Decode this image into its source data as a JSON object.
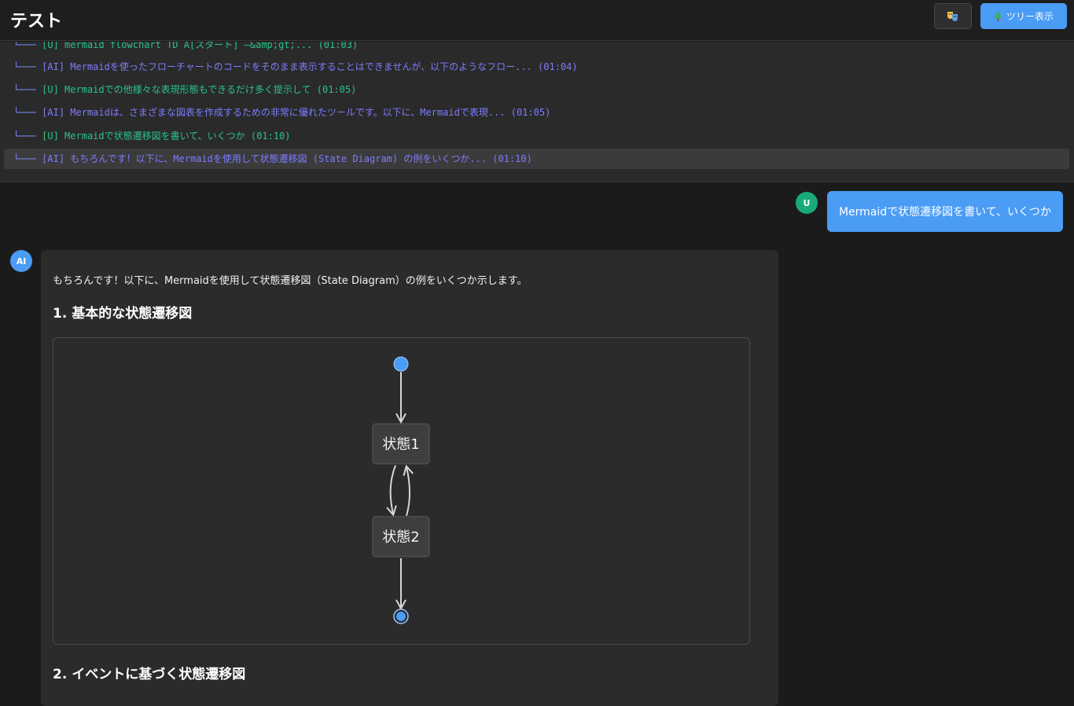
{
  "app": {
    "title": "テスト",
    "theme_icon": "theater-masks-icon",
    "tree_button": {
      "icon": "evergreen-tree-icon",
      "label": "ツリー表示"
    }
  },
  "tree": {
    "connector": "└───",
    "rows": [
      {
        "role": "user",
        "text": "[U]   mermaid flowchart TD A[スタート] —&amp;gt;... (01:03)"
      },
      {
        "role": "ai",
        "text": "[AI] Mermaidを使ったフローチャートのコードをそのまま表示することはできませんが、以下のようなフロー... (01:04)"
      },
      {
        "role": "user",
        "text": "[U] Mermaidでの他様々な表現形態もできるだけ多く提示して (01:05)"
      },
      {
        "role": "ai",
        "text": "[AI] Mermaidは、さまざまな図表を作成するための非常に優れたツールです。以下に、Mermaidで表現... (01:05)"
      },
      {
        "role": "user",
        "text": "[U] Mermaidで状態遷移図を書いて、いくつか (01:10)"
      },
      {
        "role": "ai",
        "text": "[AI] もちろんです！以下に、Mermaidを使用して状態遷移図 (State Diagram) の例をいくつか... (01:10)",
        "selected": true
      }
    ]
  },
  "chat": {
    "user": {
      "avatar": "U",
      "message": "Mermaidで状態遷移図を書いて、いくつか"
    },
    "ai": {
      "avatar": "AI",
      "intro": "もちろんです！以下に、Mermaidを使用して状態遷移図（State Diagram）の例をいくつか示します。",
      "heading1": "1. 基本的な状態遷移図",
      "diagram": {
        "states": [
          "状態1",
          "状態2"
        ],
        "transitions": [
          {
            "from": "[*]",
            "to": "状態1"
          },
          {
            "from": "状態1",
            "to": "状態2"
          },
          {
            "from": "状態2",
            "to": "状態1"
          },
          {
            "from": "状態2",
            "to": "[*]"
          }
        ]
      },
      "heading2": "2. イベントに基づく状態遷移図"
    }
  },
  "colors": {
    "accent": "#4a9cf5",
    "user_avatar": "#1aa97b",
    "tree_user_text": "#2bc38a",
    "tree_ai_text": "#7f7cff"
  }
}
